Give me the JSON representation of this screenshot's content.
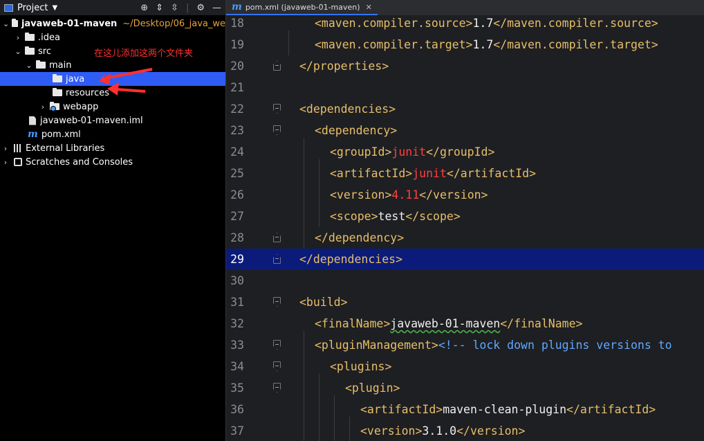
{
  "project_panel": {
    "title": "Project",
    "tree": [
      {
        "label": "javaweb-01-maven",
        "path": "~/Desktop/06_java_we"
      },
      {
        "label": ".idea"
      },
      {
        "label": "src"
      },
      {
        "label": "main"
      },
      {
        "label": "java"
      },
      {
        "label": "resources"
      },
      {
        "label": "webapp"
      },
      {
        "label": "javaweb-01-maven.iml"
      },
      {
        "label": "pom.xml"
      },
      {
        "label": "External Libraries"
      },
      {
        "label": "Scratches and Consoles"
      }
    ],
    "annotation": "在这儿添加这两个文件夹"
  },
  "editor": {
    "tab": {
      "label": "pom.xml (javaweb-01-maven)"
    },
    "lines": [
      {
        "n": "18",
        "t1": "<maven.compiler.source>",
        "v": "1.7",
        "t2": "</maven.compiler.source>"
      },
      {
        "n": "19",
        "t1": "<maven.compiler.target>",
        "v": "1.7",
        "t2": "</maven.compiler.target>"
      },
      {
        "n": "20",
        "t1": "</properties>"
      },
      {
        "n": "21"
      },
      {
        "n": "22",
        "t1": "<dependencies>"
      },
      {
        "n": "23",
        "t1": "<dependency>"
      },
      {
        "n": "24",
        "t1": "<groupId>",
        "v": "junit",
        "t2": "</groupId>"
      },
      {
        "n": "25",
        "t1": "<artifactId>",
        "v": "junit",
        "t2": "</artifactId>"
      },
      {
        "n": "26",
        "t1": "<version>",
        "v": "4.11",
        "t2": "</version>"
      },
      {
        "n": "27",
        "t1": "<scope>",
        "v": "test",
        "t2": "</scope>"
      },
      {
        "n": "28",
        "t1": "</dependency>"
      },
      {
        "n": "29",
        "t1": "</dependencies>"
      },
      {
        "n": "30"
      },
      {
        "n": "31",
        "t1": "<build>"
      },
      {
        "n": "32",
        "t1": "<finalName>",
        "v": "javaweb-01-maven",
        "t2": "</finalName>"
      },
      {
        "n": "33",
        "t1": "<pluginManagement>",
        "c": "<!-- lock down plugins versions to"
      },
      {
        "n": "34",
        "t1": "<plugins>"
      },
      {
        "n": "35",
        "t1": "<plugin>"
      },
      {
        "n": "36",
        "t1": "<artifactId>",
        "v": "maven-clean-plugin",
        "t2": "</artifactId>"
      },
      {
        "n": "37",
        "t1": "<version>",
        "v": "3.1.0",
        "t2": "</version>"
      }
    ]
  },
  "colors": {
    "tag": "#e8bf6a",
    "red_value": "#ff4040",
    "comment": "#5fa8ff",
    "selection": "#2f5cf5",
    "current_line": "#0b1b7a"
  }
}
